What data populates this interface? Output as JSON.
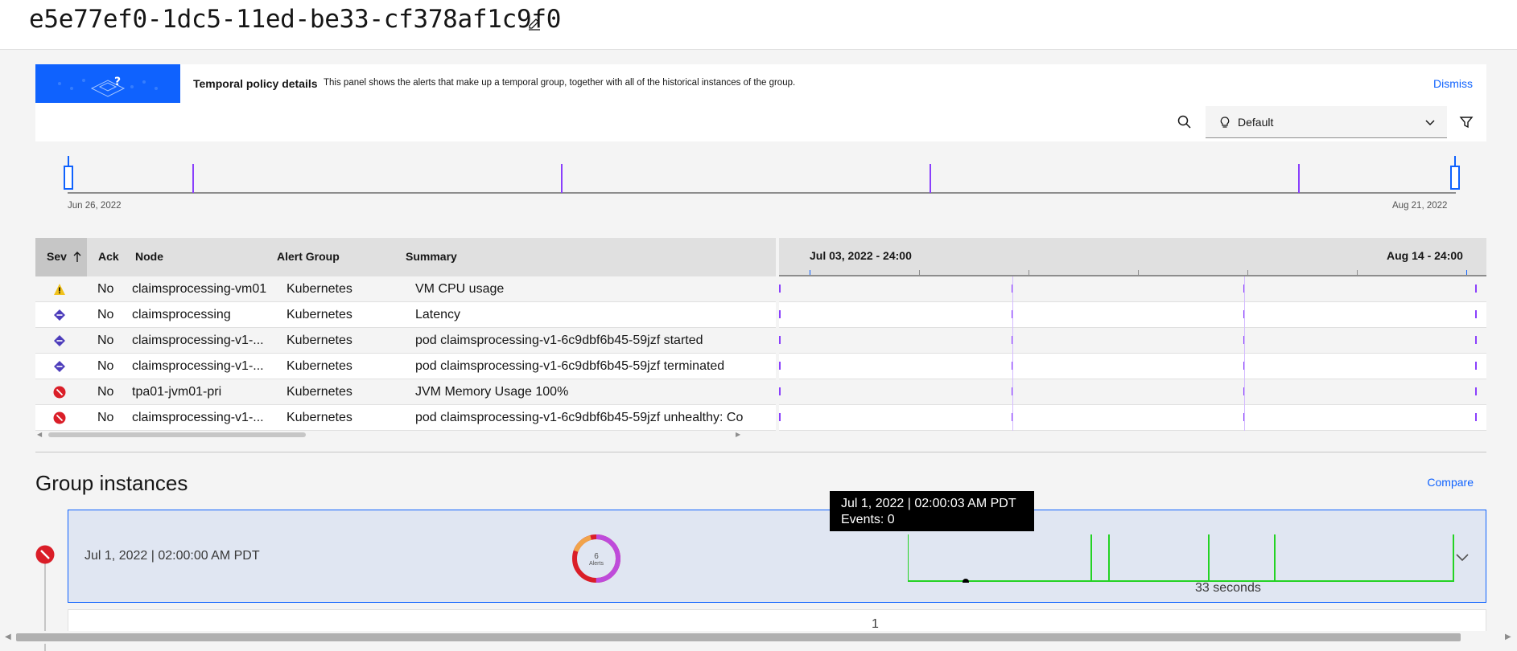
{
  "header": {
    "title": "e5e77ef0-1dc5-11ed-be33-cf378af1c9f0"
  },
  "banner": {
    "title": "Temporal policy details",
    "description": "This panel shows the alerts that make up a temporal group, together with all of the historical instances of the group.",
    "dismiss_label": "Dismiss"
  },
  "toolbar": {
    "view_label": "Default"
  },
  "timeline": {
    "start_date": "Jun 26, 2022",
    "end_date": "Aug 21, 2022"
  },
  "grid": {
    "columns": {
      "sev": "Sev",
      "ack": "Ack",
      "node": "Node",
      "alert_group": "Alert Group",
      "summary": "Summary"
    },
    "timeline_start": "Jul 03, 2022 - 24:00",
    "timeline_end": "Aug 14 - 24:00",
    "rows": [
      {
        "severity": "warning",
        "ack": "No",
        "node": "claimsprocessing-vm01",
        "alert_group": "Kubernetes",
        "summary": "VM CPU usage"
      },
      {
        "severity": "minor",
        "ack": "No",
        "node": "claimsprocessing",
        "alert_group": "Kubernetes",
        "summary": "Latency"
      },
      {
        "severity": "minor",
        "ack": "No",
        "node": "claimsprocessing-v1-...",
        "alert_group": "Kubernetes",
        "summary": "pod claimsprocessing-v1-6c9dbf6b45-59jzf started"
      },
      {
        "severity": "minor",
        "ack": "No",
        "node": "claimsprocessing-v1-...",
        "alert_group": "Kubernetes",
        "summary": "pod claimsprocessing-v1-6c9dbf6b45-59jzf terminated"
      },
      {
        "severity": "critical",
        "ack": "No",
        "node": "tpa01-jvm01-pri",
        "alert_group": "Kubernetes",
        "summary": "JVM Memory Usage 100%"
      },
      {
        "severity": "critical",
        "ack": "No",
        "node": "claimsprocessing-v1-...",
        "alert_group": "Kubernetes",
        "summary": "pod claimsprocessing-v1-6c9dbf6b45-59jzf unhealthy: Co"
      }
    ]
  },
  "group_instances": {
    "title": "Group instances",
    "compare_label": "Compare",
    "instance": {
      "date": "Jul 1, 2022 | 02:00:00 AM PDT",
      "alert_count": "6",
      "alert_label": "Alerts",
      "duration": "33 seconds"
    },
    "tooltip": {
      "line1": "Jul 1, 2022 | 02:00:03 AM PDT",
      "line2": "Events: 0"
    },
    "page_number": "1"
  },
  "colors": {
    "accent": "#0f62fe",
    "critical": "#da1e28",
    "warning": "#f1c21b",
    "minor": "#4d3dbb",
    "timeline_mark": "#8a3ffc",
    "spark": "#24d324"
  }
}
